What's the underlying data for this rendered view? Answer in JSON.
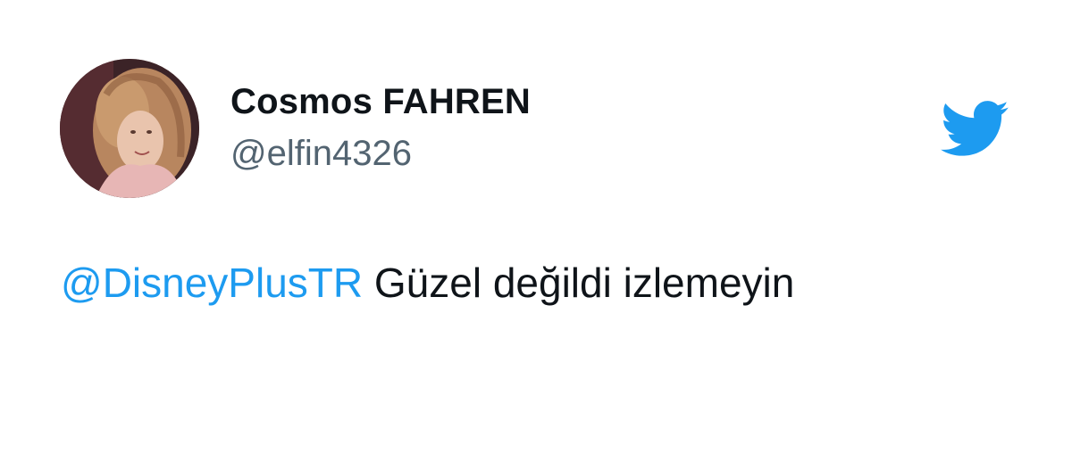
{
  "tweet": {
    "author": {
      "display_name": "Cosmos FAHREN",
      "handle": "@elfin4326",
      "avatar_icon": "user-avatar-photo"
    },
    "logo_icon": "twitter-bird-icon",
    "text": {
      "mention": "@DisneyPlusTR",
      "body": " Güzel değildi izlemeyin"
    },
    "colors": {
      "brand": "#1d9bf0",
      "name": "#0f1419",
      "handle": "#536471",
      "background": "#ffffff"
    }
  }
}
